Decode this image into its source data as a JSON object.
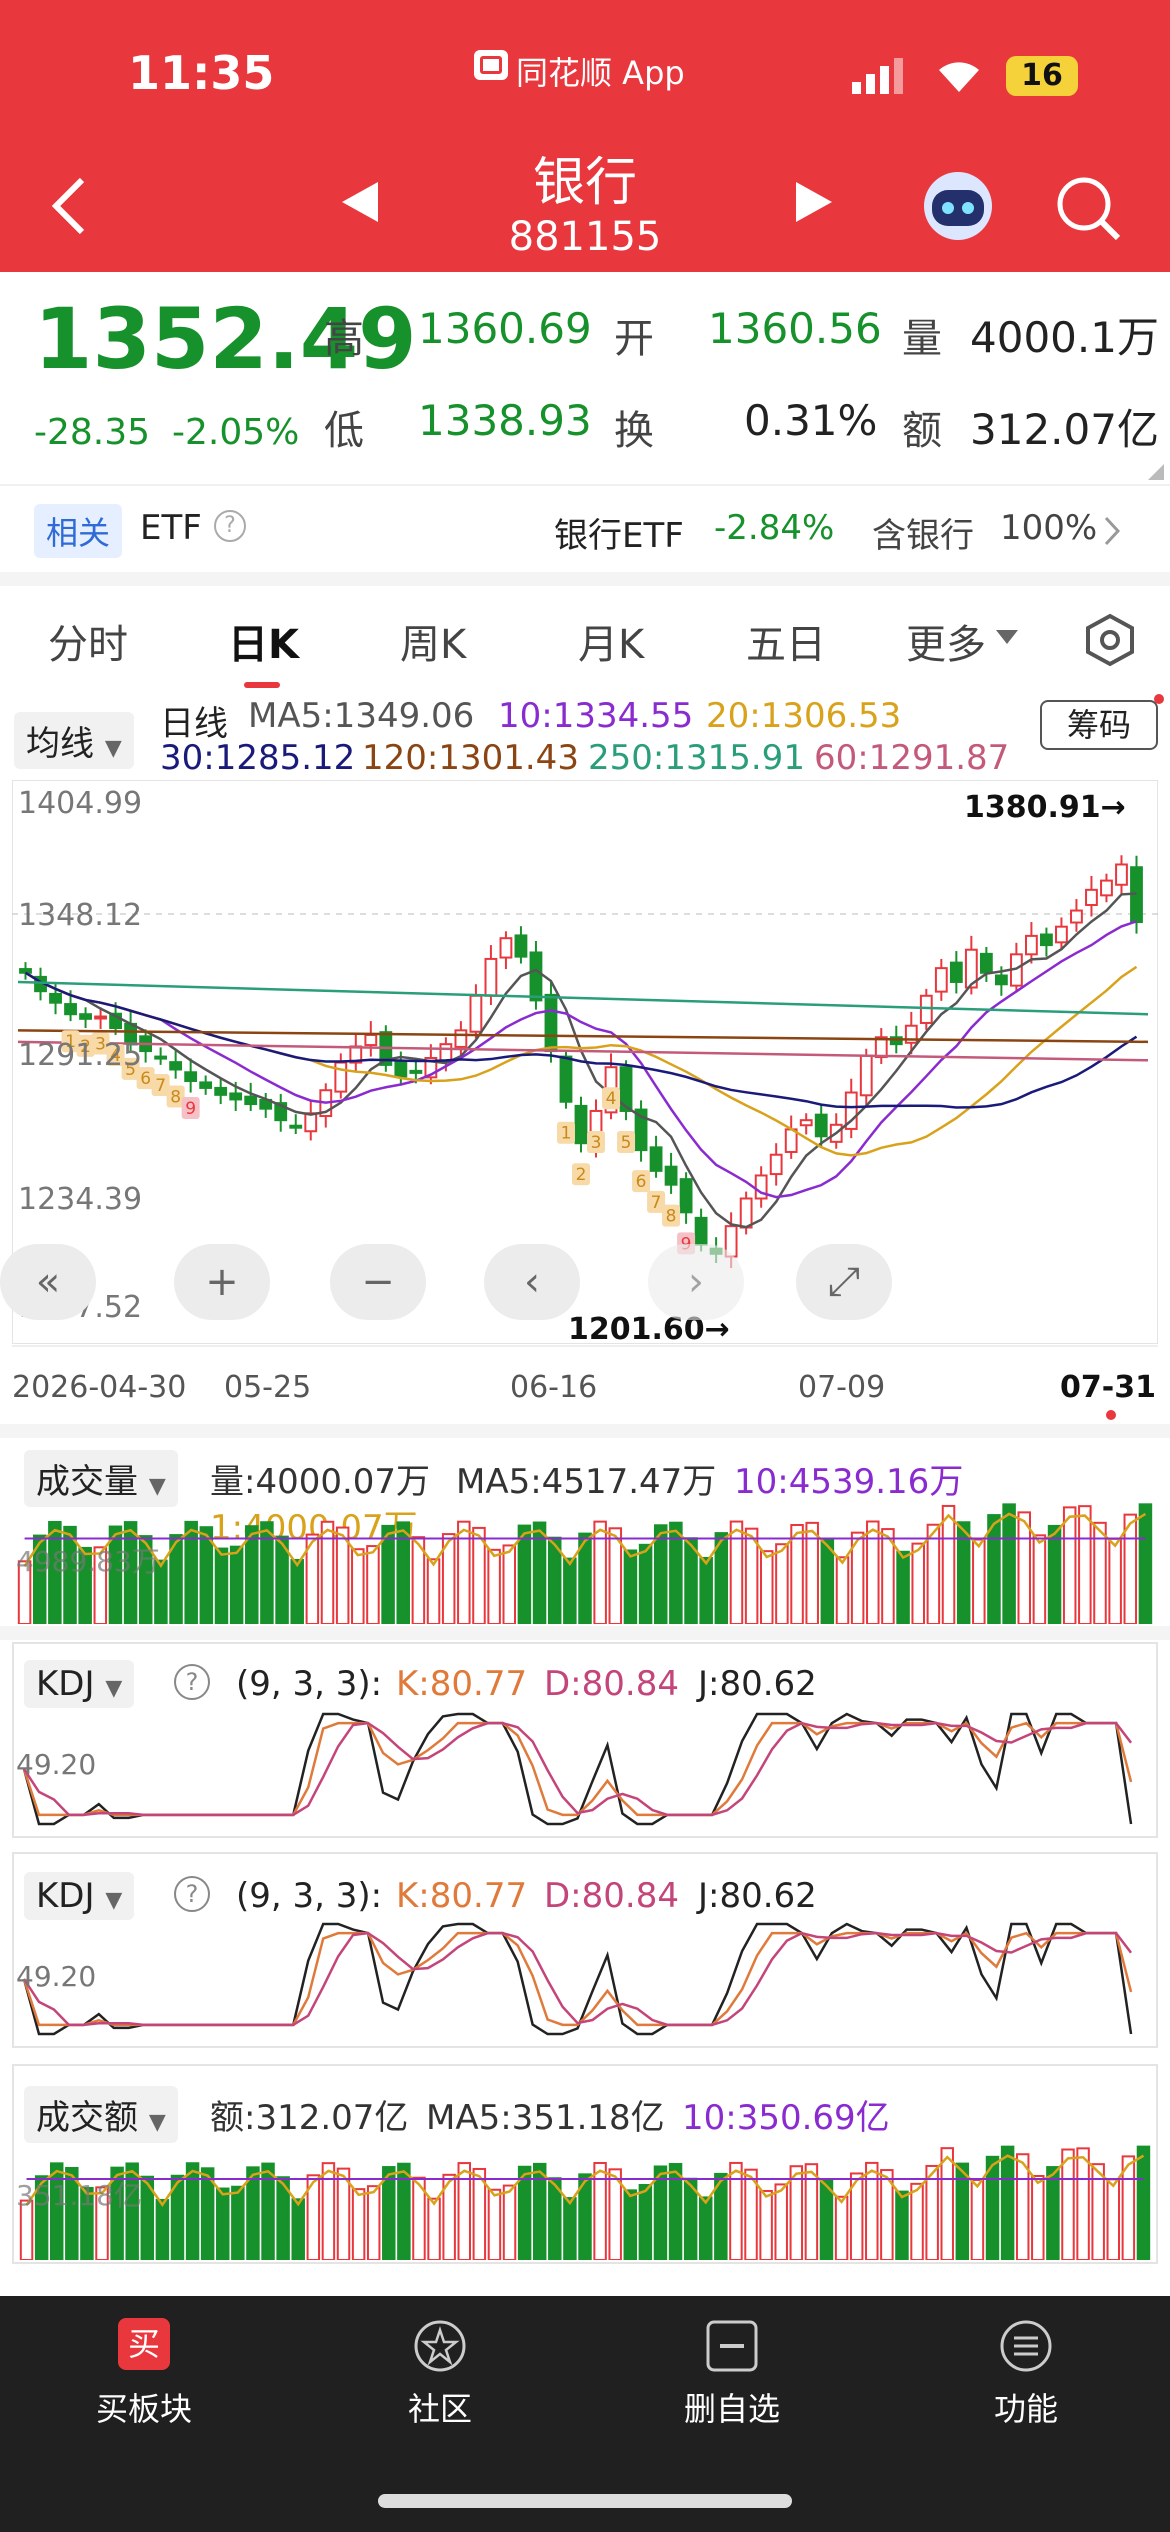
{
  "status_bar": {
    "time": "11:35",
    "app_name": "同花顺 App",
    "battery": "16"
  },
  "header": {
    "title": "银行",
    "code": "881155"
  },
  "quote": {
    "price": "1352.49",
    "change": "-28.35",
    "change_pct": "-2.05%",
    "high_label": "高",
    "high": "1360.69",
    "open_label": "开",
    "open": "1360.56",
    "vol_label": "量",
    "volume": "4000.1万",
    "low_label": "低",
    "low": "1338.93",
    "turnover_label": "换",
    "turnover": "0.31%",
    "amount_label": "额",
    "amount": "312.07亿"
  },
  "related": {
    "tag": "相关",
    "etf_label": "ETF",
    "etf_name": "银行ETF",
    "etf_change": "-2.84%",
    "contain_text": "含银行",
    "contain_pct": "100%"
  },
  "tabs": [
    {
      "label": "分时"
    },
    {
      "label": "日K"
    },
    {
      "label": "周K"
    },
    {
      "label": "月K"
    },
    {
      "label": "五日"
    },
    {
      "label": "更多"
    }
  ],
  "ma": {
    "dropdown": "均线",
    "kind": "日线",
    "chip_button": "筹码",
    "ma5": "MA5:1349.06",
    "ma10": "10:1334.55",
    "ma20": "20:1306.53",
    "ma30": "30:1285.12",
    "ma120": "120:1301.43",
    "ma250": "250:1315.91",
    "ma60": "60:1291.87"
  },
  "chart_axis": {
    "y_ticks": [
      "1404.99",
      "1348.12",
      "1291.25",
      "1234.39",
      "1177.52"
    ],
    "high_marker": "1380.91→",
    "low_marker": "1201.60→",
    "dates": [
      "2026-04-30",
      "05-25",
      "06-16",
      "07-09",
      "07-31"
    ]
  },
  "volume": {
    "dropdown": "成交量",
    "vol": "量:4000.07万",
    "ma5": "MA5:4517.47万",
    "ma10": "10:4539.16万",
    "ma1": "1:4000.07万",
    "axis_label": "4989.83万"
  },
  "kdj1": {
    "dropdown": "KDJ",
    "params": "(9, 3, 3):",
    "k": "K:80.77",
    "d": "D:80.84",
    "j": "J:80.62",
    "axis_label": "49.20"
  },
  "kdj2": {
    "dropdown": "KDJ",
    "params": "(9, 3, 3):",
    "k": "K:80.77",
    "d": "D:80.84",
    "j": "J:80.62",
    "axis_label": "49.20"
  },
  "amount": {
    "dropdown": "成交额",
    "amt": "额:312.07亿",
    "ma5": "MA5:351.18亿",
    "ma10": "10:350.69亿",
    "axis_label": "351.18亿"
  },
  "bottom_nav": [
    {
      "label": "买板块",
      "icon_char": "买"
    },
    {
      "label": "社区"
    },
    {
      "label": "删自选"
    },
    {
      "label": "功能"
    }
  ],
  "colors": {
    "red": "#e8373d",
    "green": "#16912b"
  },
  "chart_data": {
    "type": "candlestick",
    "ylim": [
      1177.52,
      1404.99
    ],
    "x_ticks": [
      "2026-04-30",
      "05-25",
      "06-16",
      "07-09",
      "07-31"
    ],
    "high": 1380.91,
    "low": 1201.6,
    "closes": [
      1330,
      1322,
      1317,
      1312,
      1310,
      1311,
      1306,
      1300,
      1296,
      1293,
      1288,
      1283,
      1280,
      1277,
      1275,
      1273,
      1271,
      1266,
      1263,
      1269,
      1279,
      1291,
      1298,
      1303,
      1290,
      1285,
      1287,
      1293,
      1299,
      1305,
      1320,
      1336,
      1345,
      1337,
      1318,
      1296,
      1274,
      1256,
      1270,
      1289,
      1270,
      1253,
      1244,
      1238,
      1226,
      1212,
      1208,
      1220,
      1232,
      1242,
      1251,
      1262,
      1266,
      1259,
      1264,
      1278,
      1294,
      1302,
      1299,
      1307,
      1320,
      1332,
      1326,
      1340,
      1330,
      1325,
      1338,
      1346,
      1342,
      1350,
      1357,
      1366,
      1370,
      1377,
      1352
    ],
    "td9_sell_down": [
      "1",
      "2",
      "3",
      "4",
      "5",
      "6",
      "7",
      "8",
      "9"
    ],
    "td9_buy": [
      "1",
      "2",
      "3",
      "4",
      "5",
      "6",
      "7",
      "8",
      "9"
    ]
  }
}
